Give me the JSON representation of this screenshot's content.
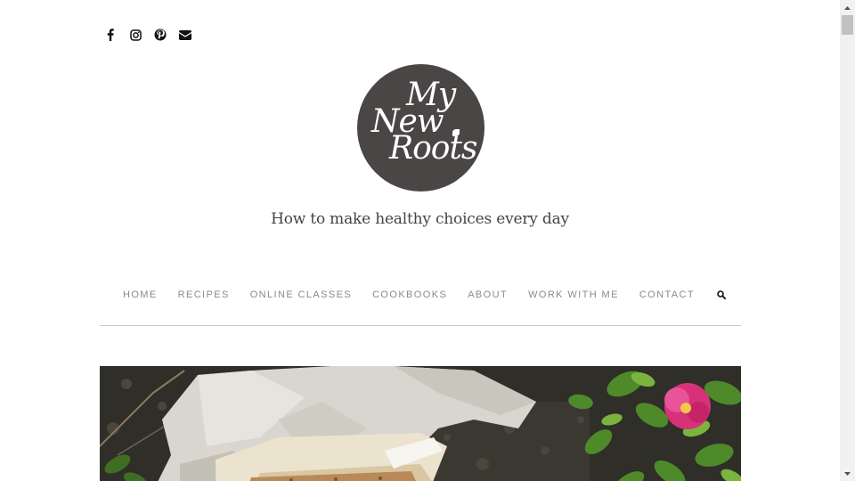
{
  "header": {
    "social_icons": [
      "facebook-icon",
      "instagram-icon",
      "pinterest-icon",
      "envelope-icon"
    ],
    "logo": {
      "line1": "My",
      "line2": "New",
      "line3": "Roots",
      "background": "#4a4646"
    },
    "tagline": "How to make healthy choices every day"
  },
  "nav": {
    "items": [
      "HOME",
      "RECIPES",
      "ONLINE CLASSES",
      "COOKBOOKS",
      "ABOUT",
      "WORK WITH ME",
      "CONTACT"
    ],
    "search_icon": "search-icon",
    "color": "#8a8a8a"
  },
  "hero": {
    "icon": "hero-photo"
  }
}
